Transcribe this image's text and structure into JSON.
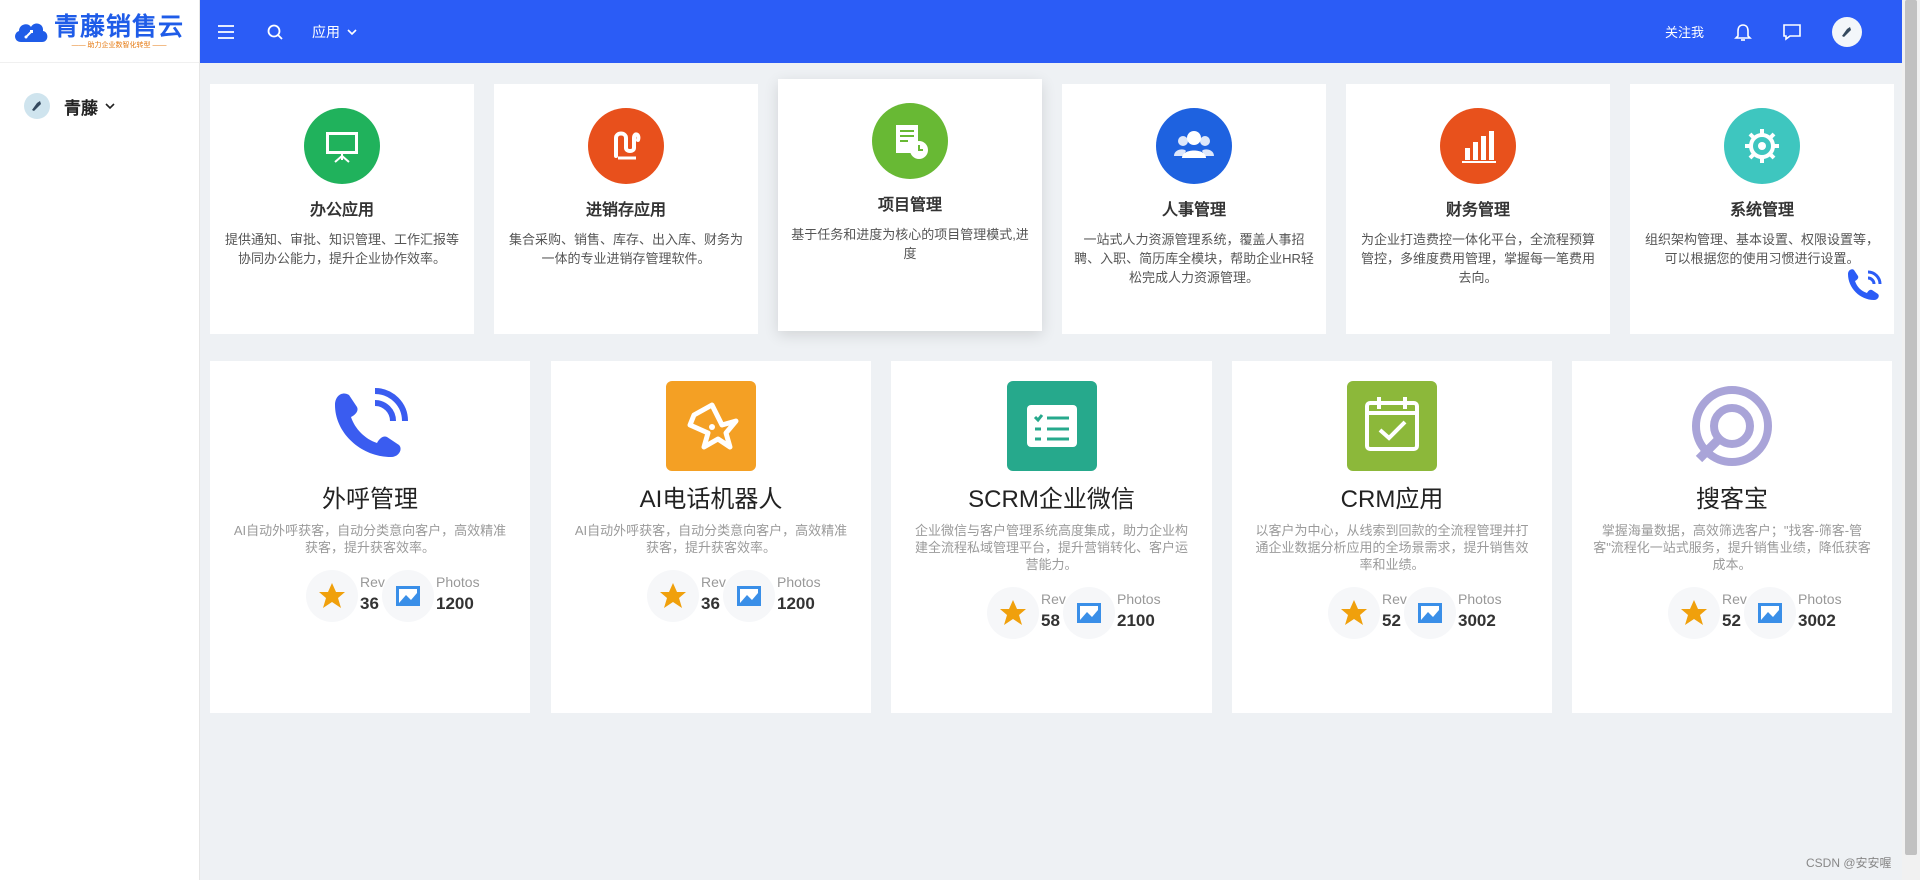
{
  "brand": {
    "title": "青藤销售云",
    "subtitle": "—— 助力企业数智化转型 ——"
  },
  "sidebar": {
    "user": "青藤"
  },
  "header": {
    "apps_label": "应用",
    "follow_label": "关注我"
  },
  "row1": [
    {
      "title": "办公应用",
      "desc": "提供通知、审批、知识管理、工作汇报等协同办公能力，提升企业协作效率。",
      "color": "#20b25c",
      "icon": "presentation-icon"
    },
    {
      "title": "进销存应用",
      "desc": "集合采购、销售、库存、出入库、财务为一体的专业进销存管理软件。",
      "color": "#e8501c",
      "icon": "inventory-icon"
    },
    {
      "title": "项目管理",
      "desc": "基于任务和进度为核心的项目管理模式,进度",
      "color": "#68b934",
      "icon": "project-icon"
    },
    {
      "title": "人事管理",
      "desc": "一站式人力资源管理系统，覆盖人事招聘、入职、简历库全模块，帮助企业HR轻松完成人力资源管理。",
      "color": "#1e62e0",
      "icon": "people-icon"
    },
    {
      "title": "财务管理",
      "desc": "为企业打造费控一体化平台，全流程预算管控，多维度费用管理，掌握每一笔费用去向。",
      "color": "#e8511c",
      "icon": "bar-chart-icon"
    },
    {
      "title": "系统管理",
      "desc": "组织架构管理、基本设置、权限设置等，可以根据您的使用习惯进行设置。",
      "color": "#3ec6bf",
      "icon": "gear-icon"
    }
  ],
  "row2": [
    {
      "title": "外呼管理",
      "desc": "AI自动外呼获客，自动分类意向客户，高效精准获客，提升获客效率。",
      "reviews_label": "Rev",
      "reviews": "36",
      "photos_label": "Photos",
      "photos": "1200",
      "icon": "phone-call-icon"
    },
    {
      "title": "AI电话机器人",
      "desc": "AI自动外呼获客，自动分类意向客户，高效精准获客，提升获客效率。",
      "reviews_label": "Rev",
      "reviews": "36",
      "photos_label": "Photos",
      "photos": "1200",
      "icon": "robot-icon",
      "color": "#f4a024"
    },
    {
      "title": "SCRM企业微信",
      "desc": "企业微信与客户管理系统高度集成，助力企业构建全流程私域管理平台，提升营销转化、客户运营能力。",
      "reviews_label": "Rev",
      "reviews": "58",
      "photos_label": "Photos",
      "photos": "2100",
      "icon": "checklist-icon",
      "color": "#26a98c"
    },
    {
      "title": "CRM应用",
      "desc": "以客户为中心，从线索到回款的全流程管理并打通企业数据分析应用的全场景需求，提升销售效率和业绩。",
      "reviews_label": "Rev",
      "reviews": "52",
      "photos_label": "Photos",
      "photos": "3002",
      "icon": "calendar-check-icon",
      "color": "#8cb83a"
    },
    {
      "title": "搜客宝",
      "desc": "掌握海量数据，高效筛选客户；\"找客-筛客-管客\"流程化一站式服务，提升销售业绩，降低获客成本。",
      "reviews_label": "Rev",
      "reviews": "52",
      "photos_label": "Photos",
      "photos": "3002",
      "icon": "search-logo-icon",
      "color": "#a9a4d8"
    }
  ],
  "watermark": "CSDN @安安喔"
}
